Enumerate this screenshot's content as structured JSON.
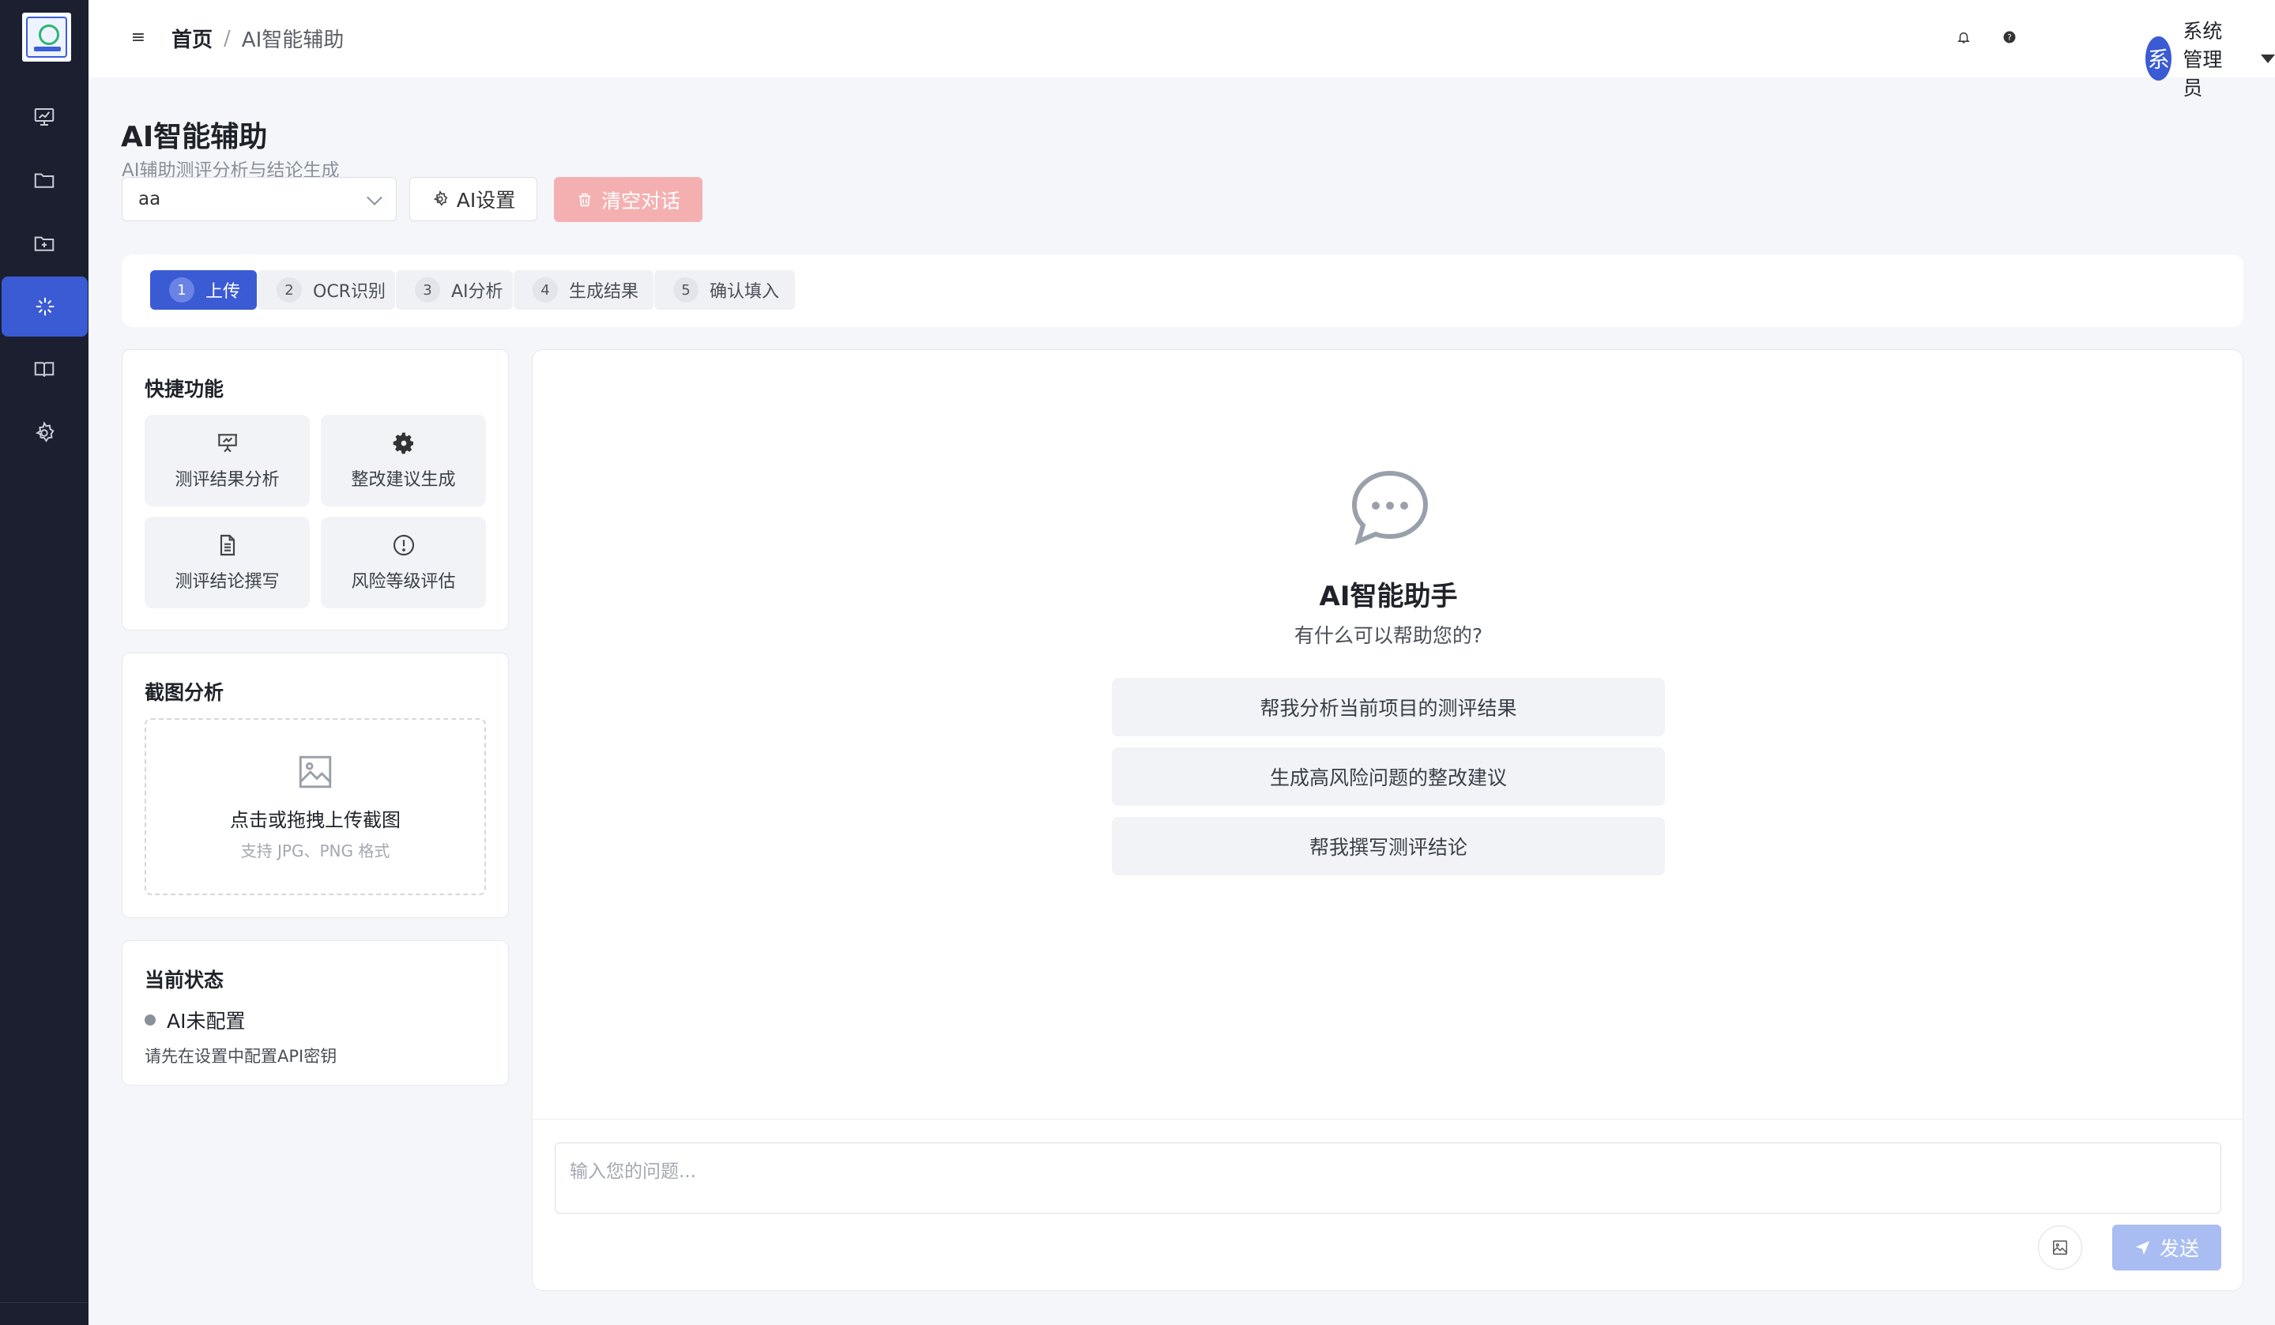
{
  "breadcrumb": {
    "home": "首页",
    "separator": "/",
    "current": "AI智能辅助"
  },
  "header": {
    "user_avatar": "系",
    "user_name": "系统管理员",
    "icons": [
      "bell-icon",
      "help-icon"
    ]
  },
  "sidebar": {
    "items": [
      {
        "icon": "chart-board-icon",
        "active": false
      },
      {
        "icon": "folder-icon",
        "active": false
      },
      {
        "icon": "folder-add-icon",
        "active": false
      },
      {
        "icon": "sparkle-icon",
        "active": true
      },
      {
        "icon": "book-icon",
        "active": false
      },
      {
        "icon": "gear-icon",
        "active": false
      }
    ]
  },
  "page": {
    "title": "AI智能辅助",
    "subtitle": "AI辅助测评分析与结论生成",
    "select_value": "aa",
    "ai_settings_label": "AI设置",
    "clear_label": "清空对话"
  },
  "steps": [
    {
      "num": "1",
      "label": "上传",
      "active": true
    },
    {
      "num": "2",
      "label": "OCR识别",
      "active": false
    },
    {
      "num": "3",
      "label": "AI分析",
      "active": false
    },
    {
      "num": "4",
      "label": "生成结果",
      "active": false
    },
    {
      "num": "5",
      "label": "确认填入",
      "active": false
    }
  ],
  "quick": {
    "title": "快捷功能",
    "items": [
      {
        "label": "测评结果分析",
        "icon": "presentation-icon"
      },
      {
        "label": "整改建议生成",
        "icon": "gear-icon"
      },
      {
        "label": "测评结论撰写",
        "icon": "document-icon"
      },
      {
        "label": "风险等级评估",
        "icon": "warning-circle-icon"
      }
    ]
  },
  "screenshot": {
    "title": "截图分析",
    "upload_title": "点击或拖拽上传截图",
    "upload_hint": "支持 JPG、PNG 格式"
  },
  "status": {
    "title": "当前状态",
    "state": "AI未配置",
    "hint": "请先在设置中配置API密钥"
  },
  "chat": {
    "assistant_title": "AI智能助手",
    "assistant_sub": "有什么可以帮助您的?",
    "suggestions": [
      "帮我分析当前项目的测评结果",
      "生成高风险问题的整改建议",
      "帮我撰写测评结论"
    ],
    "input_placeholder": "输入您的问题...",
    "send_label": "发送"
  },
  "colors": {
    "primary": "#3b5bd4",
    "sidebar_bg": "#1b1f30",
    "danger_light": "#f4b0b0",
    "send_disabled": "#a9bdf3"
  }
}
